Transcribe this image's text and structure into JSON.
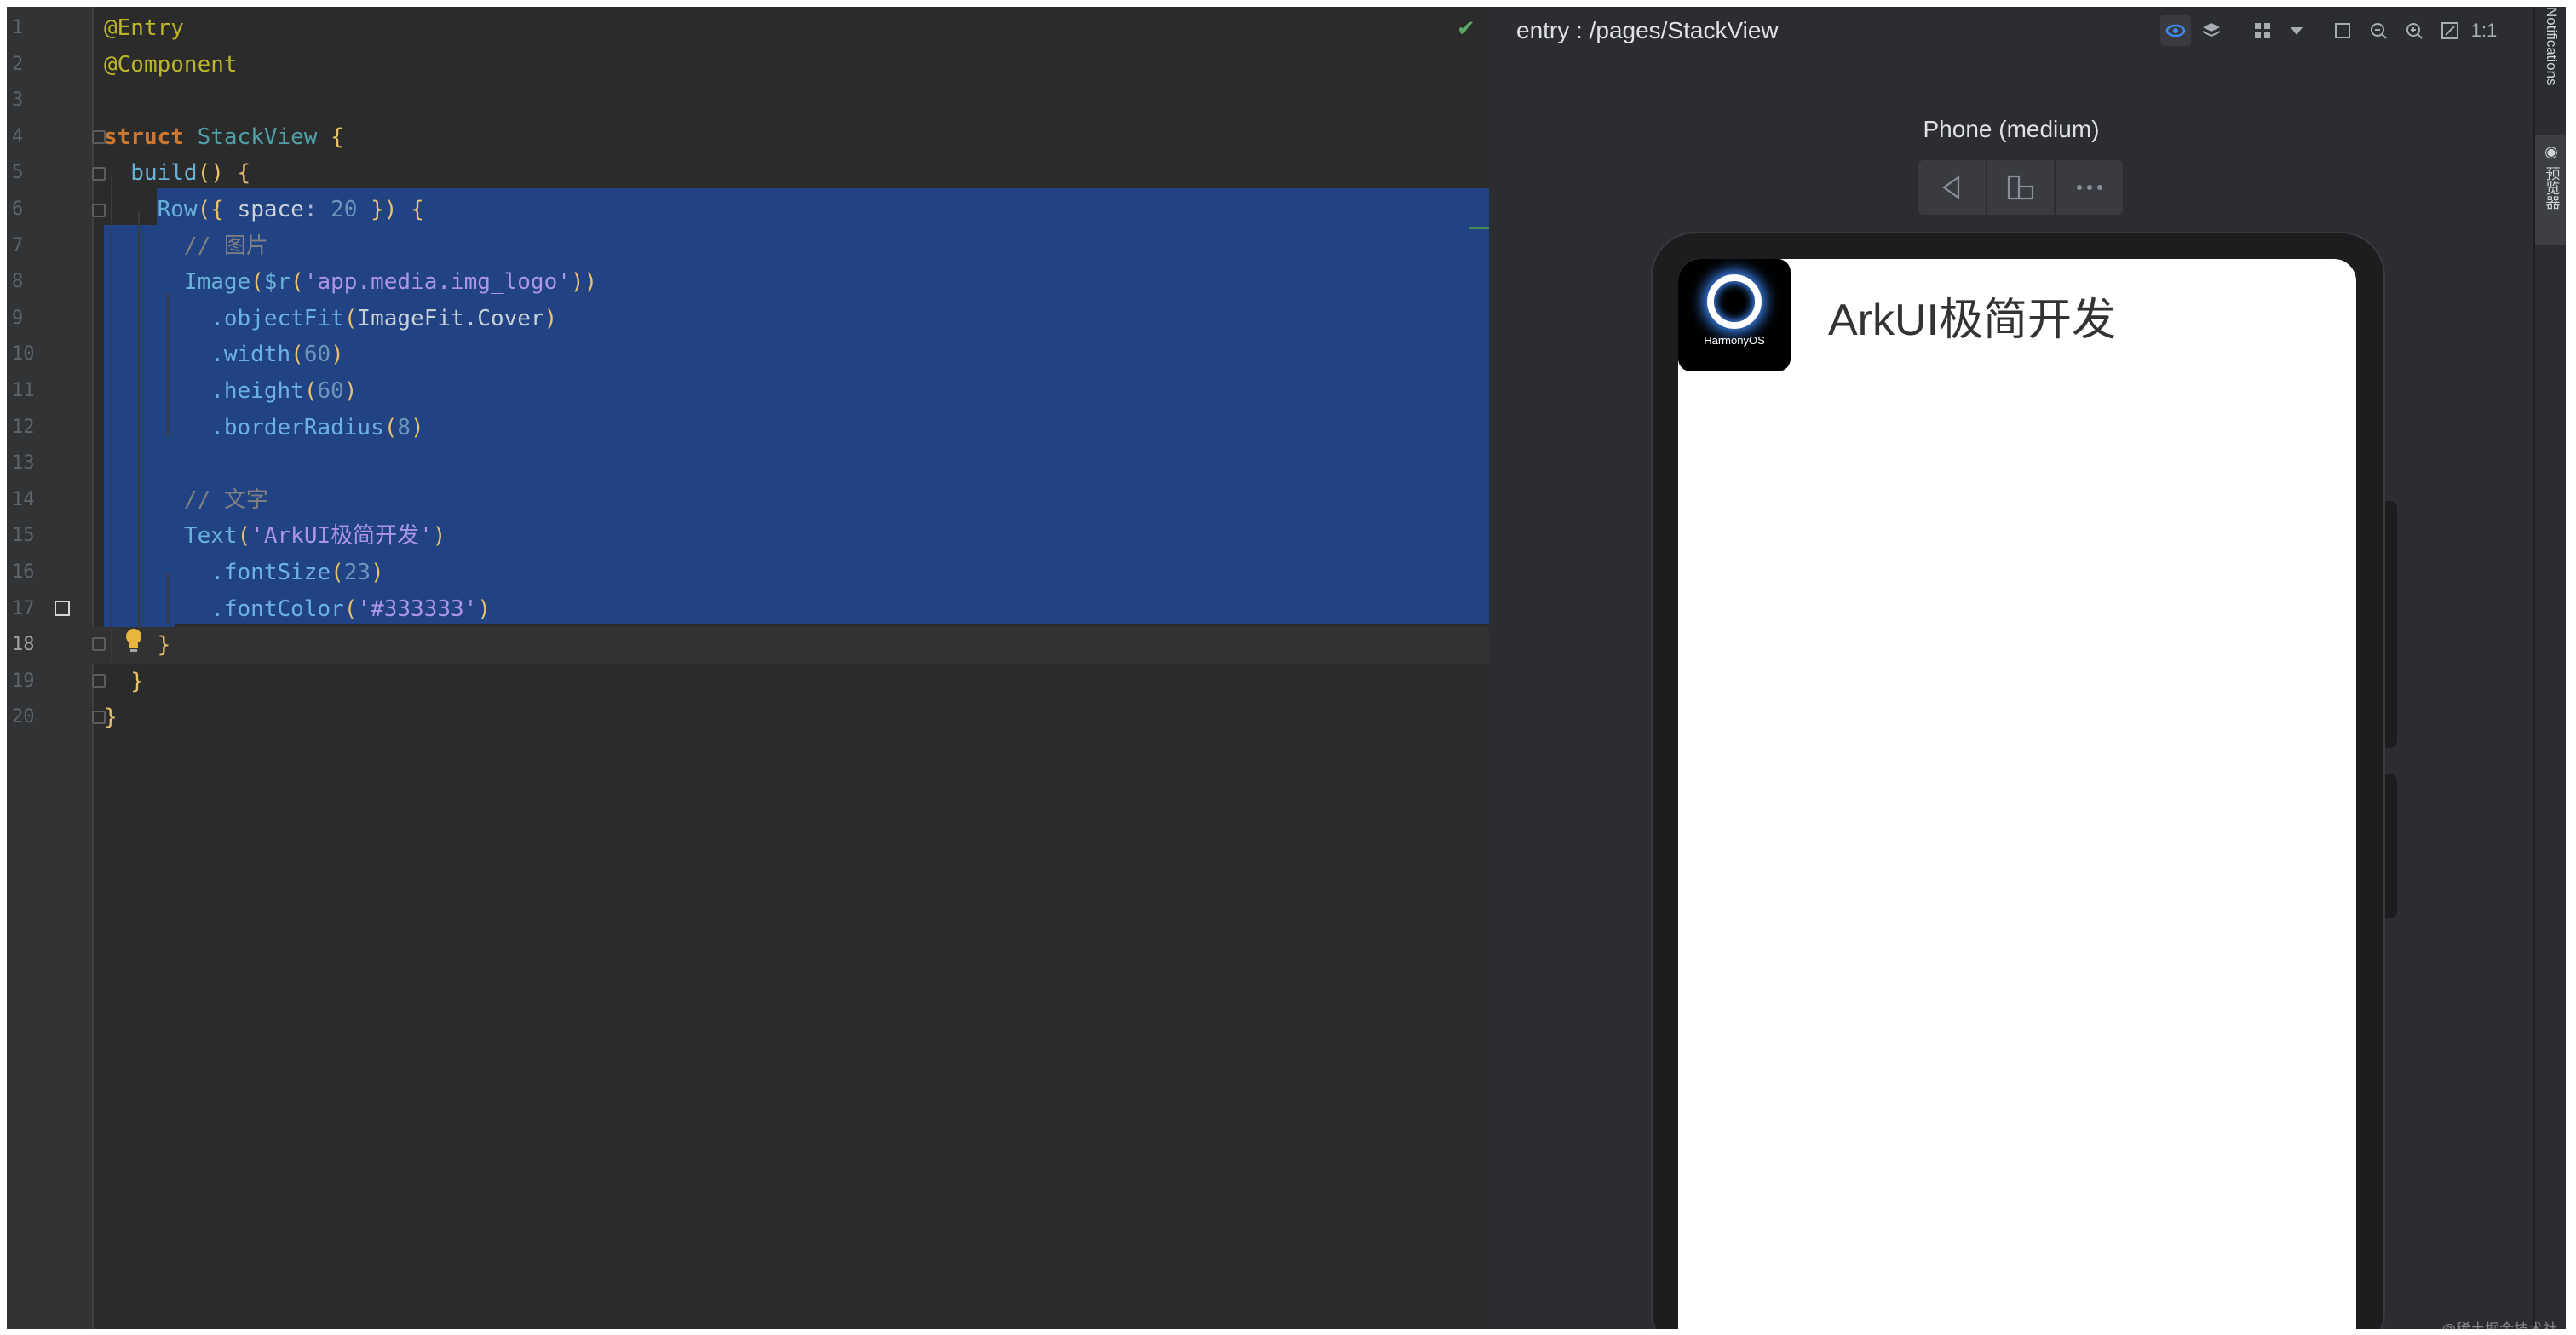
{
  "editor": {
    "status_icon": "check-icon",
    "lines": [
      {
        "num": "1",
        "tokens": [
          {
            "t": "@Entry",
            "c": "t-ann"
          }
        ]
      },
      {
        "num": "2",
        "tokens": [
          {
            "t": "@Component",
            "c": "t-ann"
          }
        ]
      },
      {
        "num": "3",
        "tokens": []
      },
      {
        "num": "4",
        "tokens": [
          {
            "t": "struct ",
            "c": "t-kw"
          },
          {
            "t": "StackView",
            "c": "t-struct"
          },
          {
            "t": " {",
            "c": "t-brace"
          }
        ]
      },
      {
        "num": "5",
        "tokens": [
          {
            "t": "  build",
            "c": "t-fn"
          },
          {
            "t": "() {",
            "c": "t-brace"
          }
        ]
      },
      {
        "num": "6",
        "tokens": [
          {
            "t": "    ",
            "c": "t-plain"
          },
          {
            "t": "Row",
            "c": "t-fn"
          },
          {
            "t": "({ ",
            "c": "t-brace"
          },
          {
            "t": "space",
            "c": "t-const"
          },
          {
            "t": ": ",
            "c": "t-plain"
          },
          {
            "t": "20",
            "c": "t-num"
          },
          {
            "t": " }) {",
            "c": "t-brace"
          }
        ]
      },
      {
        "num": "7",
        "tokens": [
          {
            "t": "      // 图片",
            "c": "t-com"
          }
        ]
      },
      {
        "num": "8",
        "tokens": [
          {
            "t": "      Image",
            "c": "t-fn"
          },
          {
            "t": "(",
            "c": "t-brace"
          },
          {
            "t": "$r",
            "c": "t-fn"
          },
          {
            "t": "(",
            "c": "t-brace"
          },
          {
            "t": "'app.media.img_logo'",
            "c": "t-str"
          },
          {
            "t": "))",
            "c": "t-brace"
          }
        ]
      },
      {
        "num": "9",
        "tokens": [
          {
            "t": "        .objectFit",
            "c": "t-method"
          },
          {
            "t": "(",
            "c": "t-brace"
          },
          {
            "t": "ImageFit.Cover",
            "c": "t-const"
          },
          {
            "t": ")",
            "c": "t-brace"
          }
        ]
      },
      {
        "num": "10",
        "tokens": [
          {
            "t": "        .width",
            "c": "t-method"
          },
          {
            "t": "(",
            "c": "t-brace"
          },
          {
            "t": "60",
            "c": "t-num"
          },
          {
            "t": ")",
            "c": "t-brace"
          }
        ]
      },
      {
        "num": "11",
        "tokens": [
          {
            "t": "        .height",
            "c": "t-method"
          },
          {
            "t": "(",
            "c": "t-brace"
          },
          {
            "t": "60",
            "c": "t-num"
          },
          {
            "t": ")",
            "c": "t-brace"
          }
        ]
      },
      {
        "num": "12",
        "tokens": [
          {
            "t": "        .borderRadius",
            "c": "t-method"
          },
          {
            "t": "(",
            "c": "t-brace"
          },
          {
            "t": "8",
            "c": "t-num"
          },
          {
            "t": ")",
            "c": "t-brace"
          }
        ]
      },
      {
        "num": "13",
        "tokens": []
      },
      {
        "num": "14",
        "tokens": [
          {
            "t": "      // 文字",
            "c": "t-com"
          }
        ]
      },
      {
        "num": "15",
        "tokens": [
          {
            "t": "      Text",
            "c": "t-fn"
          },
          {
            "t": "(",
            "c": "t-brace"
          },
          {
            "t": "'ArkUI极简开发'",
            "c": "t-str"
          },
          {
            "t": ")",
            "c": "t-brace"
          }
        ]
      },
      {
        "num": "16",
        "tokens": [
          {
            "t": "        .fontSize",
            "c": "t-method"
          },
          {
            "t": "(",
            "c": "t-brace"
          },
          {
            "t": "23",
            "c": "t-num"
          },
          {
            "t": ")",
            "c": "t-brace"
          }
        ]
      },
      {
        "num": "17",
        "tokens": [
          {
            "t": "        .fontColor",
            "c": "t-method"
          },
          {
            "t": "(",
            "c": "t-brace"
          },
          {
            "t": "'#333333'",
            "c": "t-str"
          },
          {
            "t": ")",
            "c": "t-brace"
          }
        ]
      },
      {
        "num": "18",
        "tokens": [
          {
            "t": "    }",
            "c": "t-brace"
          }
        ]
      },
      {
        "num": "19",
        "tokens": [
          {
            "t": "  }",
            "c": "t-brace"
          }
        ]
      },
      {
        "num": "20",
        "tokens": [
          {
            "t": "}",
            "c": "t-brace"
          }
        ]
      }
    ],
    "current_line": "18"
  },
  "previewer": {
    "title": "entry : /pages/StackView",
    "device_label": "Phone (medium)",
    "toolbar_icons": [
      "inspector-icon",
      "layers-icon",
      "grid-icon",
      "dropdown-icon",
      "frame-icon",
      "zoom-out-icon",
      "zoom-in-icon",
      "fit-icon"
    ],
    "zoom_label": "1:1",
    "device_buttons": [
      "back-icon",
      "rotate-icon",
      "more-icon"
    ],
    "app": {
      "logo_text": "HarmonyOS",
      "text": "ArkUI极简开发",
      "text_color": "#333333"
    }
  },
  "tool_strip": {
    "notifications_label": "Notifications",
    "preview_label": "预览器"
  },
  "watermark": "@稀土掘金技术社区",
  "colors": {
    "selection": "#214283",
    "editor_bg": "#2b2b2b",
    "previewer_bg": "#2b2d30"
  }
}
